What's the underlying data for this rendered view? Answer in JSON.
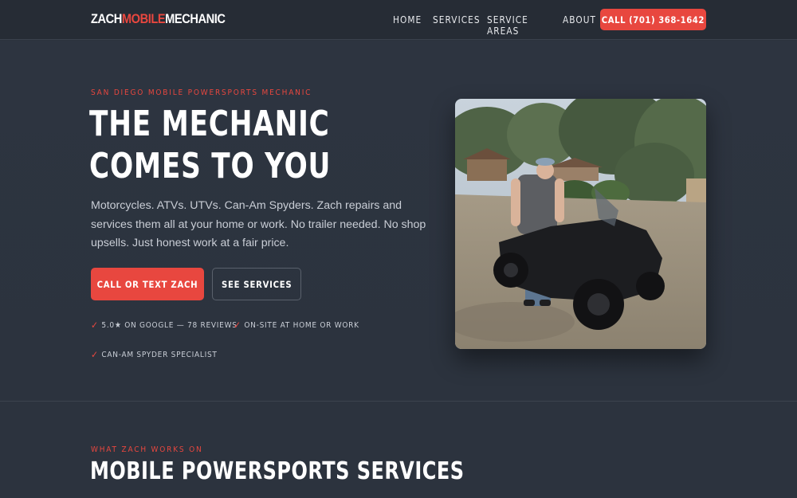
{
  "nav": {
    "logo_part1": "ZACH",
    "logo_part2": "MOBILE",
    "logo_part3": "MECHANIC",
    "links": [
      "HOME",
      "SERVICES",
      "SERVICE AREAS",
      "ABOUT"
    ],
    "call_button": "CALL (701) 368-1642"
  },
  "hero": {
    "eyebrow": "SAN DIEGO MOBILE POWERSPORTS MECHANIC",
    "headline": "THE MECHANIC COMES TO YOU",
    "lead": "Motorcycles. ATVs. UTVs. Can-Am Spyders. Zach repairs and services them all at your home or work. No trailer needed. No shop upsells. Just honest work at a fair price.",
    "primary_button": "CALL OR TEXT ZACH",
    "secondary_button": "SEE SERVICES",
    "trust": [
      "5.0★ ON GOOGLE — 78 REVIEWS",
      "ON-SITE AT HOME OR WORK",
      "CAN-AM SPYDER SPECIALIST"
    ],
    "check_mark": "✓"
  },
  "services_section": {
    "eyebrow": "WHAT ZACH WORKS ON",
    "title": "MOBILE POWERSPORTS SERVICES"
  },
  "colors": {
    "accent": "#e8473f",
    "background": "#2c333e",
    "nav_background": "#262c35"
  }
}
